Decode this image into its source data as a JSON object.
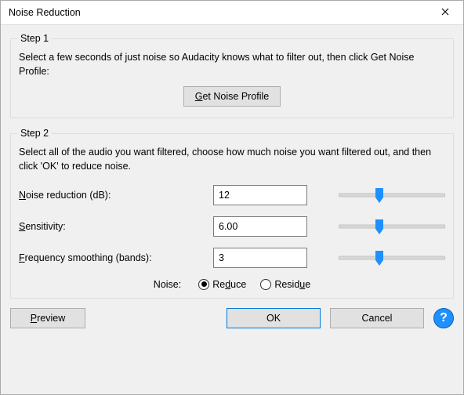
{
  "window": {
    "title": "Noise Reduction"
  },
  "step1": {
    "legend": "Step 1",
    "instructions": "Select a few seconds of just noise so Audacity knows what to filter out, then click Get Noise Profile:",
    "get_profile_label_pre": "G",
    "get_profile_label_post": "et Noise Profile"
  },
  "step2": {
    "legend": "Step 2",
    "instructions": "Select all of the audio you want filtered, choose how much noise you want filtered out, and then click 'OK' to reduce noise.",
    "params": {
      "noise_reduction": {
        "label_pre": "N",
        "label_post": "oise reduction (dB):",
        "value": "12",
        "slider_pct": 38
      },
      "sensitivity": {
        "label_pre": "S",
        "label_post": "ensitivity:",
        "value": "6.00",
        "slider_pct": 38
      },
      "freq_smoothing": {
        "label_pre": "F",
        "label_post": "requency smoothing (bands):",
        "value": "3",
        "slider_pct": 38
      }
    },
    "noise_mode": {
      "lead": "Noise:",
      "reduce_pre": "Re",
      "reduce_u": "d",
      "reduce_post": "uce",
      "residue_pre": "Resid",
      "residue_u": "u",
      "residue_post": "e",
      "selected": "reduce"
    }
  },
  "footer": {
    "preview_u": "P",
    "preview_post": "review",
    "ok": "OK",
    "cancel": "Cancel",
    "help": "?"
  }
}
